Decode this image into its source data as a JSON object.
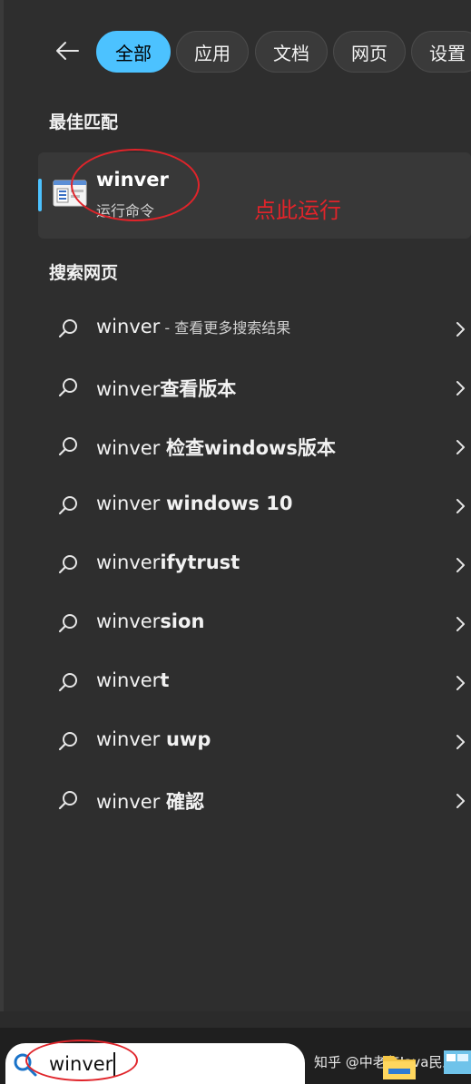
{
  "filters": {
    "back_label": "←",
    "tabs": [
      {
        "label": "全部",
        "active": true
      },
      {
        "label": "应用",
        "active": false
      },
      {
        "label": "文档",
        "active": false
      },
      {
        "label": "网页",
        "active": false
      },
      {
        "label": "设置",
        "active": false
      }
    ]
  },
  "best_match": {
    "section_title": "最佳匹配",
    "name": "winver",
    "type": "运行命令",
    "annotation": "点此运行"
  },
  "web_search": {
    "section_title": "搜索网页",
    "results": [
      {
        "prefix": "winver",
        "bold": "",
        "suffix": " - 查看更多搜索结果"
      },
      {
        "prefix": "winver",
        "bold": "查看版本",
        "suffix": ""
      },
      {
        "prefix": "winver ",
        "bold": "检查windows版本",
        "suffix": ""
      },
      {
        "prefix": "winver ",
        "bold": "windows 10",
        "suffix": ""
      },
      {
        "prefix": "winver",
        "bold": "ifytrust",
        "suffix": ""
      },
      {
        "prefix": "winver",
        "bold": "sion",
        "suffix": ""
      },
      {
        "prefix": "winver",
        "bold": "t",
        "suffix": ""
      },
      {
        "prefix": "winver ",
        "bold": "uwp",
        "suffix": ""
      },
      {
        "prefix": "winver ",
        "bold": "確認",
        "suffix": ""
      }
    ]
  },
  "taskbar": {
    "search_value": "winver",
    "watermark": "知乎 @中老年Java民工"
  },
  "colors": {
    "accent": "#4cc2ff",
    "annotation": "#e0242a"
  }
}
